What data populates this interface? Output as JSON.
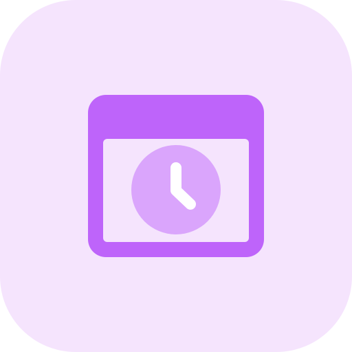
{
  "icon": {
    "name": "browser-clock-icon",
    "symbol": "clock-icon",
    "window": "browser-window-icon"
  },
  "colors": {
    "tile_background": "#F5E4FD",
    "window_primary": "#BE64FA",
    "window_body": "#F5E4FD",
    "clock_face": "#DAA5FC",
    "clock_hands": "#FFFFFF"
  }
}
